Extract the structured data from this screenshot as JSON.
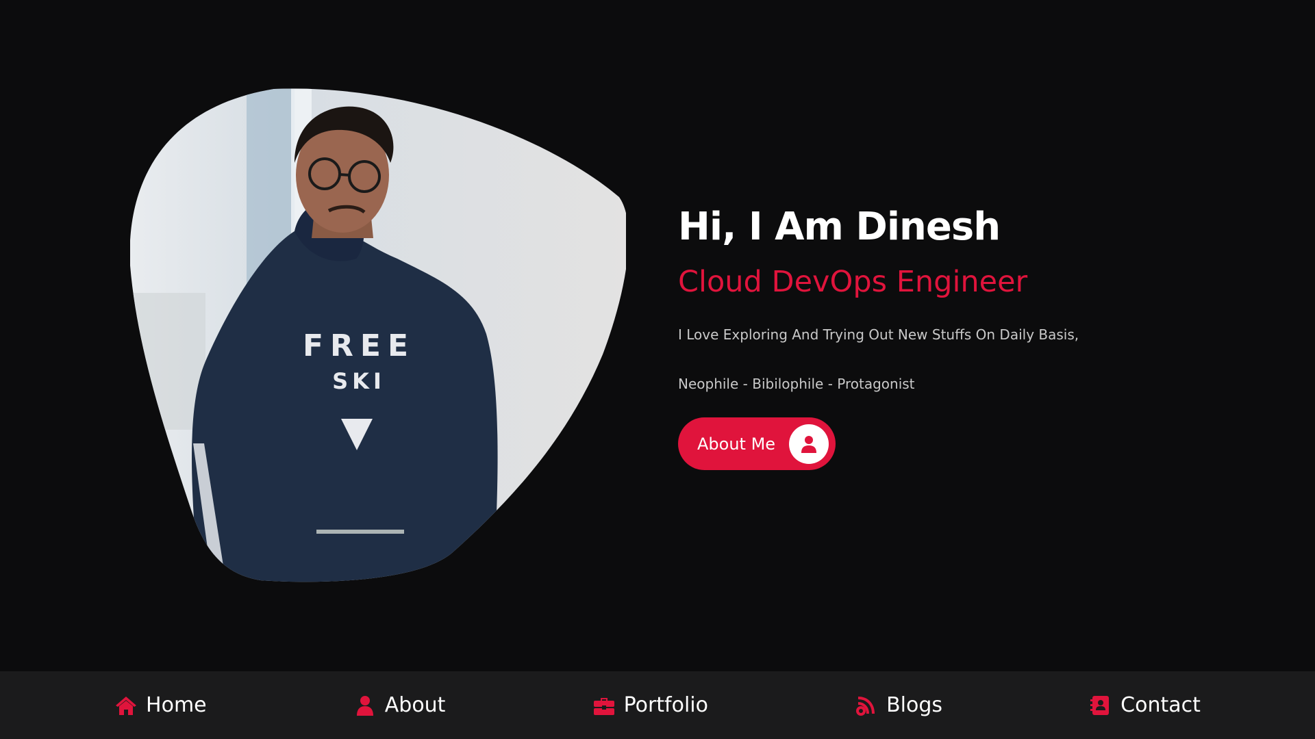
{
  "hero": {
    "greeting": "Hi, I Am Dinesh",
    "role": "Cloud DevOps Engineer",
    "tagline": "I Love Exploring And Trying Out New Stuffs On Daily Basis,",
    "traits": "Neophile - Bibilophile - Protagonist",
    "button_label": "About Me",
    "button_icon": "user-icon",
    "photo_alt": "profile-photo",
    "hoodie_text_line1": "FREE",
    "hoodie_text_line2": "SKI"
  },
  "nav": {
    "items": [
      {
        "label": "Home",
        "icon": "home-icon"
      },
      {
        "label": "About",
        "icon": "user-icon"
      },
      {
        "label": "Portfolio",
        "icon": "briefcase-icon"
      },
      {
        "label": "Blogs",
        "icon": "rss-icon"
      },
      {
        "label": "Contact",
        "icon": "address-book-icon"
      }
    ]
  },
  "colors": {
    "background": "#0c0c0d",
    "navbar": "#1b1b1c",
    "accent": "#e0143c",
    "text": "#ffffff",
    "muted": "#c9c9c9"
  }
}
